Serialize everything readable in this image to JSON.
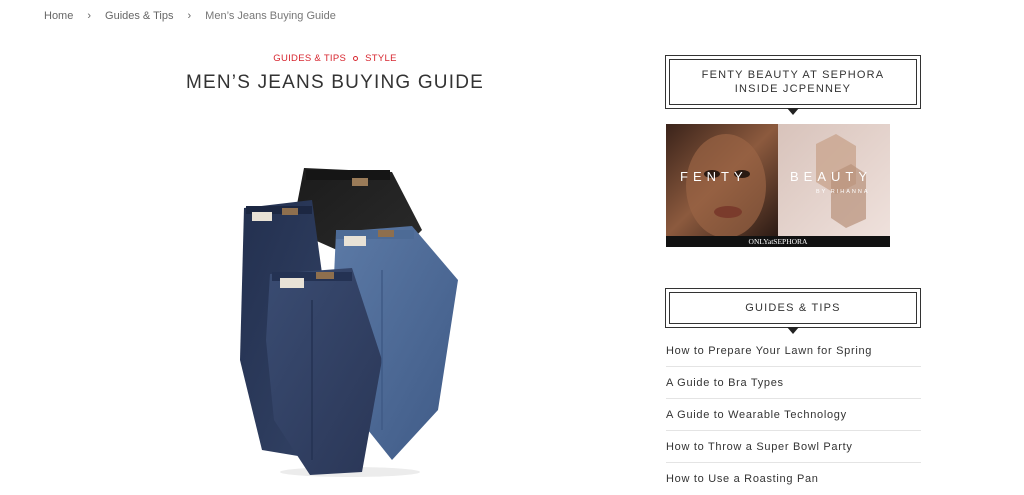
{
  "breadcrumb": {
    "home": "Home",
    "guides": "Guides & Tips",
    "current": "Men’s Jeans Buying Guide",
    "separator": "›"
  },
  "article": {
    "categories": [
      "GUIDES & TIPS",
      "STYLE"
    ],
    "title": "MEN’S JEANS BUYING GUIDE"
  },
  "sidebar": {
    "widget1_title": "FENTY BEAUTY AT SEPHORA INSIDE JCPENNEY",
    "ad": {
      "logo_word1": "FENTY",
      "logo_word2": "BEAUTY",
      "byline": "BY RIHANNA",
      "footer": "ONLYatSEPHORA"
    },
    "widget2_title": "GUIDES & TIPS",
    "guides": [
      "How to Prepare Your Lawn for Spring",
      "A Guide to Bra Types",
      "A Guide to Wearable Technology",
      "How to Throw a Super Bowl Party",
      "How to Use a Roasting Pan"
    ]
  },
  "colors": {
    "accent": "#d7262f",
    "text": "#333333",
    "divider": "#e4e4e4"
  }
}
